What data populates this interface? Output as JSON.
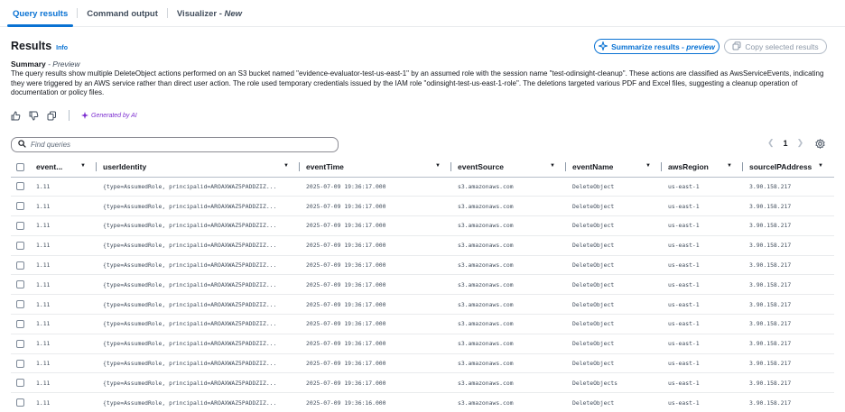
{
  "tabs": [
    {
      "label": "Query results",
      "active": true
    },
    {
      "label": "Command output",
      "active": false
    },
    {
      "label": "Visualizer - ",
      "suffix": "New",
      "active": false
    }
  ],
  "results": {
    "title": "Results",
    "info": "Info",
    "summarize_label": "Summarize results - ",
    "summarize_suffix": "preview",
    "copy_label": "Copy selected results"
  },
  "summary": {
    "label": "Summary",
    "preview": " - Preview",
    "text": "The query results show multiple DeleteObject actions performed on an S3 bucket named \"evidence-evaluator-test-us-east-1\" by an assumed role with the session name \"test-odinsight-cleanup\". These actions are classified as AwsServiceEvents, indicating they were triggered by an AWS service rather than direct user action. The role used temporary credentials issued by the IAM role \"odinsight-test-us-east-1-role\". The deletions targeted various PDF and Excel files, suggesting a cleanup operation of documentation or policy files."
  },
  "feedback": {
    "generated": "Generated by AI"
  },
  "search": {
    "placeholder": "Find queries"
  },
  "pager": {
    "page": "1"
  },
  "colors": {
    "accent": "#0972d3",
    "ai": "#7d2fd0"
  },
  "table": {
    "columns": [
      "event...",
      "userIdentity",
      "eventTime",
      "eventSource",
      "eventName",
      "awsRegion",
      "sourceIPAddress"
    ],
    "rows": [
      [
        "1.11",
        "{type=AssumedRole, principalid=AROAXWAZ5PADDZIZ...",
        "2025-07-09 19:36:17.000",
        "s3.amazonaws.com",
        "DeleteObject",
        "us-east-1",
        "3.90.158.217"
      ],
      [
        "1.11",
        "{type=AssumedRole, principalid=AROAXWAZ5PADDZIZ...",
        "2025-07-09 19:36:17.000",
        "s3.amazonaws.com",
        "DeleteObject",
        "us-east-1",
        "3.90.158.217"
      ],
      [
        "1.11",
        "{type=AssumedRole, principalid=AROAXWAZ5PADDZIZ...",
        "2025-07-09 19:36:17.000",
        "s3.amazonaws.com",
        "DeleteObject",
        "us-east-1",
        "3.90.158.217"
      ],
      [
        "1.11",
        "{type=AssumedRole, principalid=AROAXWAZ5PADDZIZ...",
        "2025-07-09 19:36:17.000",
        "s3.amazonaws.com",
        "DeleteObject",
        "us-east-1",
        "3.90.158.217"
      ],
      [
        "1.11",
        "{type=AssumedRole, principalid=AROAXWAZ5PADDZIZ...",
        "2025-07-09 19:36:17.000",
        "s3.amazonaws.com",
        "DeleteObject",
        "us-east-1",
        "3.90.158.217"
      ],
      [
        "1.11",
        "{type=AssumedRole, principalid=AROAXWAZ5PADDZIZ...",
        "2025-07-09 19:36:17.000",
        "s3.amazonaws.com",
        "DeleteObject",
        "us-east-1",
        "3.90.158.217"
      ],
      [
        "1.11",
        "{type=AssumedRole, principalid=AROAXWAZ5PADDZIZ...",
        "2025-07-09 19:36:17.000",
        "s3.amazonaws.com",
        "DeleteObject",
        "us-east-1",
        "3.90.158.217"
      ],
      [
        "1.11",
        "{type=AssumedRole, principalid=AROAXWAZ5PADDZIZ...",
        "2025-07-09 19:36:17.000",
        "s3.amazonaws.com",
        "DeleteObject",
        "us-east-1",
        "3.90.158.217"
      ],
      [
        "1.11",
        "{type=AssumedRole, principalid=AROAXWAZ5PADDZIZ...",
        "2025-07-09 19:36:17.000",
        "s3.amazonaws.com",
        "DeleteObject",
        "us-east-1",
        "3.90.158.217"
      ],
      [
        "1.11",
        "{type=AssumedRole, principalid=AROAXWAZ5PADDZIZ...",
        "2025-07-09 19:36:17.000",
        "s3.amazonaws.com",
        "DeleteObject",
        "us-east-1",
        "3.90.158.217"
      ],
      [
        "1.11",
        "{type=AssumedRole, principalid=AROAXWAZ5PADDZIZ...",
        "2025-07-09 19:36:17.000",
        "s3.amazonaws.com",
        "DeleteObjects",
        "us-east-1",
        "3.90.158.217"
      ],
      [
        "1.11",
        "{type=AssumedRole, principalid=AROAXWAZ5PADDZIZ...",
        "2025-07-09 19:36:16.000",
        "s3.amazonaws.com",
        "DeleteObject",
        "us-east-1",
        "3.90.158.217"
      ]
    ]
  }
}
